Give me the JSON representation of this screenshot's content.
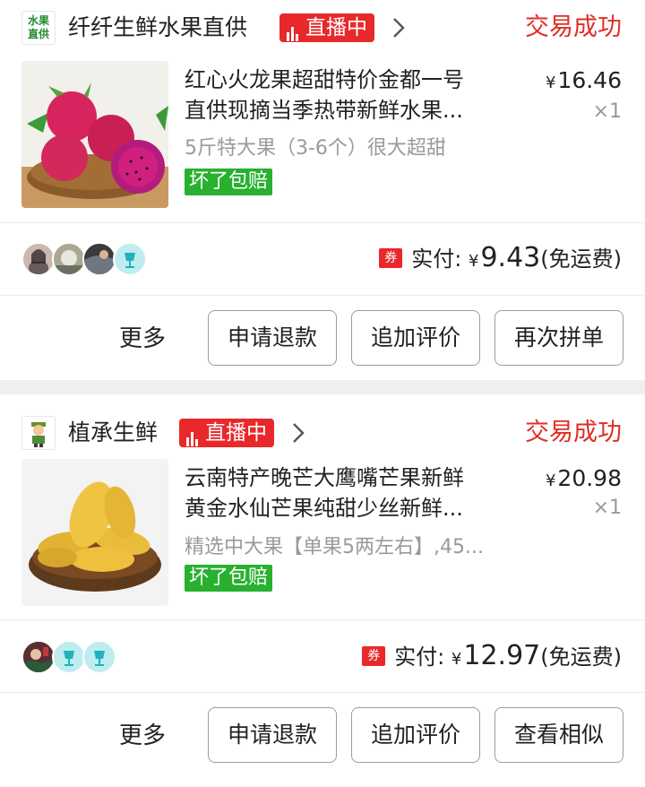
{
  "orders": [
    {
      "shop": {
        "name": "纤纤生鲜水果直供",
        "logo_text": [
          "水果",
          "直供"
        ],
        "live_label": "直播中"
      },
      "status": "交易成功",
      "product": {
        "title_line1": "红心火龙果超甜特价金都一号",
        "title_line2": "直供现摘当季热带新鲜水果...",
        "spec": "5斤特大果（3-6个）很大超甜",
        "price_symbol": "¥",
        "price": "16.46",
        "qty": "×1",
        "guarantee": "坏了包赔"
      },
      "payment": {
        "coupon": "券",
        "label": "实付:",
        "symbol": "¥",
        "amount": "9.43",
        "shipping": "(免运费)"
      },
      "actions": {
        "more": "更多",
        "buttons": [
          "申请退款",
          "追加评价",
          "再次拼单"
        ]
      }
    },
    {
      "shop": {
        "name": "植承生鲜",
        "live_label": "直播中"
      },
      "status": "交易成功",
      "product": {
        "title_line1": "云南特产晚芒大鹰嘴芒果新鲜",
        "title_line2": "黄金水仙芒果纯甜少丝新鲜...",
        "spec": "精选中大果【单果5两左右】,45...",
        "price_symbol": "¥",
        "price": "20.98",
        "qty": "×1",
        "guarantee": "坏了包赔"
      },
      "payment": {
        "coupon": "券",
        "label": "实付:",
        "symbol": "¥",
        "amount": "12.97",
        "shipping": "(免运费)"
      },
      "actions": {
        "more": "更多",
        "buttons": [
          "申请退款",
          "追加评价",
          "查看相似"
        ]
      }
    }
  ],
  "colors": {
    "accent_red": "#e02e24",
    "live_red": "#e8282b",
    "guarantee_green": "#28b02f"
  }
}
